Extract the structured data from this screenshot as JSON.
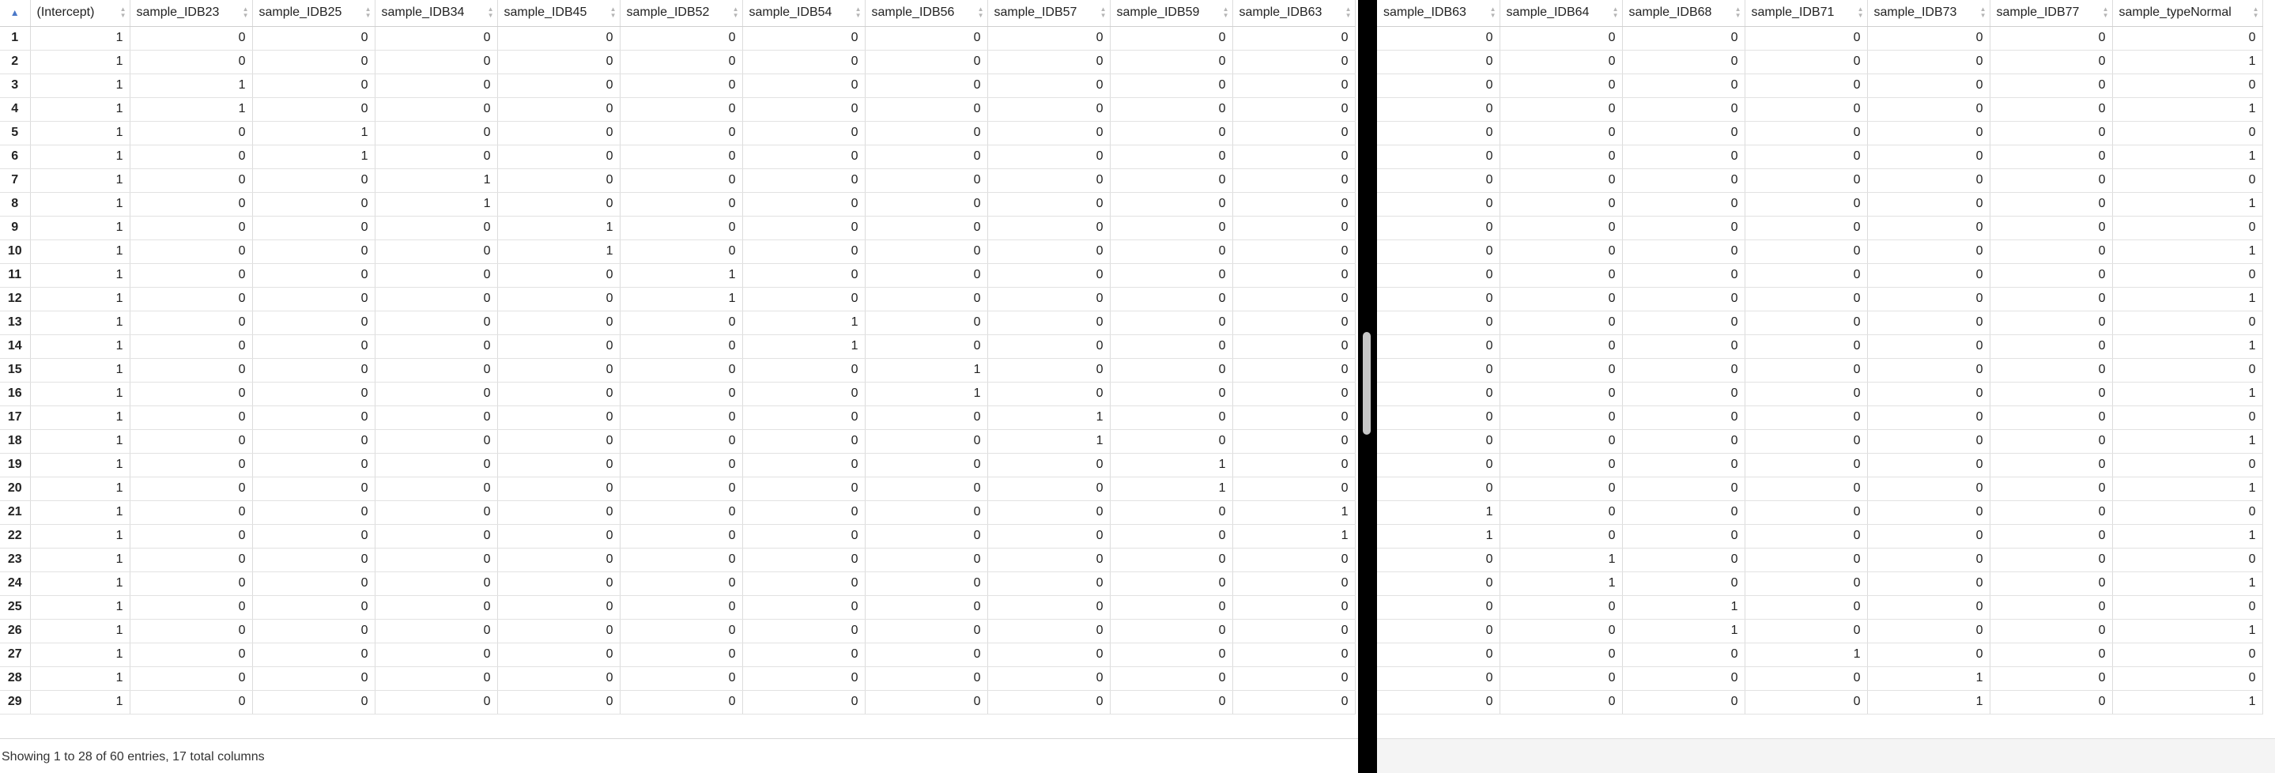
{
  "left_table": {
    "row_header_icon": "▲",
    "columns": [
      "(Intercept)",
      "sample_IDB23",
      "sample_IDB25",
      "sample_IDB34",
      "sample_IDB45",
      "sample_IDB52",
      "sample_IDB54",
      "sample_IDB56",
      "sample_IDB57",
      "sample_IDB59",
      "sample_IDB63"
    ],
    "rows": [
      [
        "1",
        "1",
        "0",
        "0",
        "0",
        "0",
        "0",
        "0",
        "0",
        "0",
        "0",
        "0"
      ],
      [
        "2",
        "1",
        "0",
        "0",
        "0",
        "0",
        "0",
        "0",
        "0",
        "0",
        "0",
        "0"
      ],
      [
        "3",
        "1",
        "1",
        "0",
        "0",
        "0",
        "0",
        "0",
        "0",
        "0",
        "0",
        "0"
      ],
      [
        "4",
        "1",
        "1",
        "0",
        "0",
        "0",
        "0",
        "0",
        "0",
        "0",
        "0",
        "0"
      ],
      [
        "5",
        "1",
        "0",
        "1",
        "0",
        "0",
        "0",
        "0",
        "0",
        "0",
        "0",
        "0"
      ],
      [
        "6",
        "1",
        "0",
        "1",
        "0",
        "0",
        "0",
        "0",
        "0",
        "0",
        "0",
        "0"
      ],
      [
        "7",
        "1",
        "0",
        "0",
        "1",
        "0",
        "0",
        "0",
        "0",
        "0",
        "0",
        "0"
      ],
      [
        "8",
        "1",
        "0",
        "0",
        "1",
        "0",
        "0",
        "0",
        "0",
        "0",
        "0",
        "0"
      ],
      [
        "9",
        "1",
        "0",
        "0",
        "0",
        "1",
        "0",
        "0",
        "0",
        "0",
        "0",
        "0"
      ],
      [
        "10",
        "1",
        "0",
        "0",
        "0",
        "1",
        "0",
        "0",
        "0",
        "0",
        "0",
        "0"
      ],
      [
        "11",
        "1",
        "0",
        "0",
        "0",
        "0",
        "1",
        "0",
        "0",
        "0",
        "0",
        "0"
      ],
      [
        "12",
        "1",
        "0",
        "0",
        "0",
        "0",
        "1",
        "0",
        "0",
        "0",
        "0",
        "0"
      ],
      [
        "13",
        "1",
        "0",
        "0",
        "0",
        "0",
        "0",
        "1",
        "0",
        "0",
        "0",
        "0"
      ],
      [
        "14",
        "1",
        "0",
        "0",
        "0",
        "0",
        "0",
        "1",
        "0",
        "0",
        "0",
        "0"
      ],
      [
        "15",
        "1",
        "0",
        "0",
        "0",
        "0",
        "0",
        "0",
        "1",
        "0",
        "0",
        "0"
      ],
      [
        "16",
        "1",
        "0",
        "0",
        "0",
        "0",
        "0",
        "0",
        "1",
        "0",
        "0",
        "0"
      ],
      [
        "17",
        "1",
        "0",
        "0",
        "0",
        "0",
        "0",
        "0",
        "0",
        "1",
        "0",
        "0"
      ],
      [
        "18",
        "1",
        "0",
        "0",
        "0",
        "0",
        "0",
        "0",
        "0",
        "1",
        "0",
        "0"
      ],
      [
        "19",
        "1",
        "0",
        "0",
        "0",
        "0",
        "0",
        "0",
        "0",
        "0",
        "1",
        "0"
      ],
      [
        "20",
        "1",
        "0",
        "0",
        "0",
        "0",
        "0",
        "0",
        "0",
        "0",
        "1",
        "0"
      ],
      [
        "21",
        "1",
        "0",
        "0",
        "0",
        "0",
        "0",
        "0",
        "0",
        "0",
        "0",
        "1"
      ],
      [
        "22",
        "1",
        "0",
        "0",
        "0",
        "0",
        "0",
        "0",
        "0",
        "0",
        "0",
        "1"
      ],
      [
        "23",
        "1",
        "0",
        "0",
        "0",
        "0",
        "0",
        "0",
        "0",
        "0",
        "0",
        "0"
      ],
      [
        "24",
        "1",
        "0",
        "0",
        "0",
        "0",
        "0",
        "0",
        "0",
        "0",
        "0",
        "0"
      ],
      [
        "25",
        "1",
        "0",
        "0",
        "0",
        "0",
        "0",
        "0",
        "0",
        "0",
        "0",
        "0"
      ],
      [
        "26",
        "1",
        "0",
        "0",
        "0",
        "0",
        "0",
        "0",
        "0",
        "0",
        "0",
        "0"
      ],
      [
        "27",
        "1",
        "0",
        "0",
        "0",
        "0",
        "0",
        "0",
        "0",
        "0",
        "0",
        "0"
      ],
      [
        "28",
        "1",
        "0",
        "0",
        "0",
        "0",
        "0",
        "0",
        "0",
        "0",
        "0",
        "0"
      ],
      [
        "29",
        "1",
        "0",
        "0",
        "0",
        "0",
        "0",
        "0",
        "0",
        "0",
        "0",
        "0"
      ]
    ],
    "footer": "Showing 1 to 28 of 60 entries, 17 total columns"
  },
  "right_table": {
    "columns": [
      "sample_IDB63",
      "sample_IDB64",
      "sample_IDB68",
      "sample_IDB71",
      "sample_IDB73",
      "sample_IDB77",
      "sample_typeNormal"
    ],
    "rows": [
      [
        "0",
        "0",
        "0",
        "0",
        "0",
        "0",
        "0"
      ],
      [
        "0",
        "0",
        "0",
        "0",
        "0",
        "0",
        "1"
      ],
      [
        "0",
        "0",
        "0",
        "0",
        "0",
        "0",
        "0"
      ],
      [
        "0",
        "0",
        "0",
        "0",
        "0",
        "0",
        "1"
      ],
      [
        "0",
        "0",
        "0",
        "0",
        "0",
        "0",
        "0"
      ],
      [
        "0",
        "0",
        "0",
        "0",
        "0",
        "0",
        "1"
      ],
      [
        "0",
        "0",
        "0",
        "0",
        "0",
        "0",
        "0"
      ],
      [
        "0",
        "0",
        "0",
        "0",
        "0",
        "0",
        "1"
      ],
      [
        "0",
        "0",
        "0",
        "0",
        "0",
        "0",
        "0"
      ],
      [
        "0",
        "0",
        "0",
        "0",
        "0",
        "0",
        "1"
      ],
      [
        "0",
        "0",
        "0",
        "0",
        "0",
        "0",
        "0"
      ],
      [
        "0",
        "0",
        "0",
        "0",
        "0",
        "0",
        "1"
      ],
      [
        "0",
        "0",
        "0",
        "0",
        "0",
        "0",
        "0"
      ],
      [
        "0",
        "0",
        "0",
        "0",
        "0",
        "0",
        "1"
      ],
      [
        "0",
        "0",
        "0",
        "0",
        "0",
        "0",
        "0"
      ],
      [
        "0",
        "0",
        "0",
        "0",
        "0",
        "0",
        "1"
      ],
      [
        "0",
        "0",
        "0",
        "0",
        "0",
        "0",
        "0"
      ],
      [
        "0",
        "0",
        "0",
        "0",
        "0",
        "0",
        "1"
      ],
      [
        "0",
        "0",
        "0",
        "0",
        "0",
        "0",
        "0"
      ],
      [
        "0",
        "0",
        "0",
        "0",
        "0",
        "0",
        "1"
      ],
      [
        "1",
        "0",
        "0",
        "0",
        "0",
        "0",
        "0"
      ],
      [
        "1",
        "0",
        "0",
        "0",
        "0",
        "0",
        "1"
      ],
      [
        "0",
        "1",
        "0",
        "0",
        "0",
        "0",
        "0"
      ],
      [
        "0",
        "1",
        "0",
        "0",
        "0",
        "0",
        "1"
      ],
      [
        "0",
        "0",
        "1",
        "0",
        "0",
        "0",
        "0"
      ],
      [
        "0",
        "0",
        "1",
        "0",
        "0",
        "0",
        "1"
      ],
      [
        "0",
        "0",
        "0",
        "1",
        "0",
        "0",
        "0"
      ],
      [
        "0",
        "0",
        "0",
        "0",
        "1",
        "0",
        "0"
      ],
      [
        "0",
        "0",
        "0",
        "0",
        "1",
        "0",
        "1"
      ]
    ]
  },
  "icons": {
    "sort": "sort-arrows-icon",
    "row_sort": "sort-ascending-icon"
  }
}
